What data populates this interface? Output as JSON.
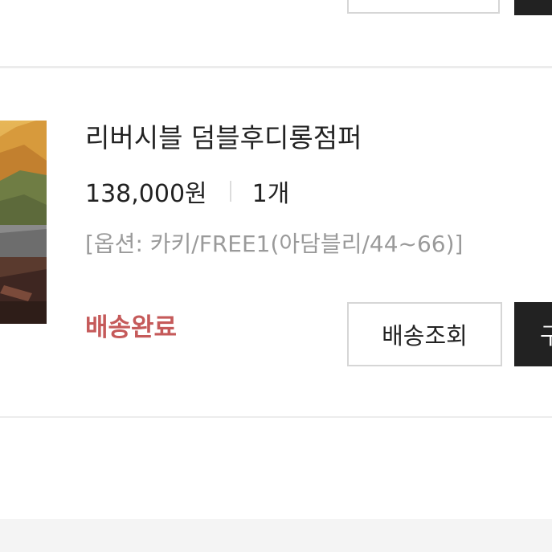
{
  "order_item": {
    "product_name": "리버시블 덤블후디롱점퍼",
    "price": "138,000원",
    "quantity": "1개",
    "option": "[옵션: 카키/FREE1(아담블리/44~66)]",
    "status": "배송완료",
    "track_button_label": "배송조회",
    "second_button_label": "구"
  },
  "colors": {
    "status": "#c55a5a",
    "dark_button": "#222222",
    "option_text": "#9a9a9a",
    "border": "#d6d6d6"
  },
  "icons": {
    "thumbnail": "product-photo-thumbnail"
  }
}
